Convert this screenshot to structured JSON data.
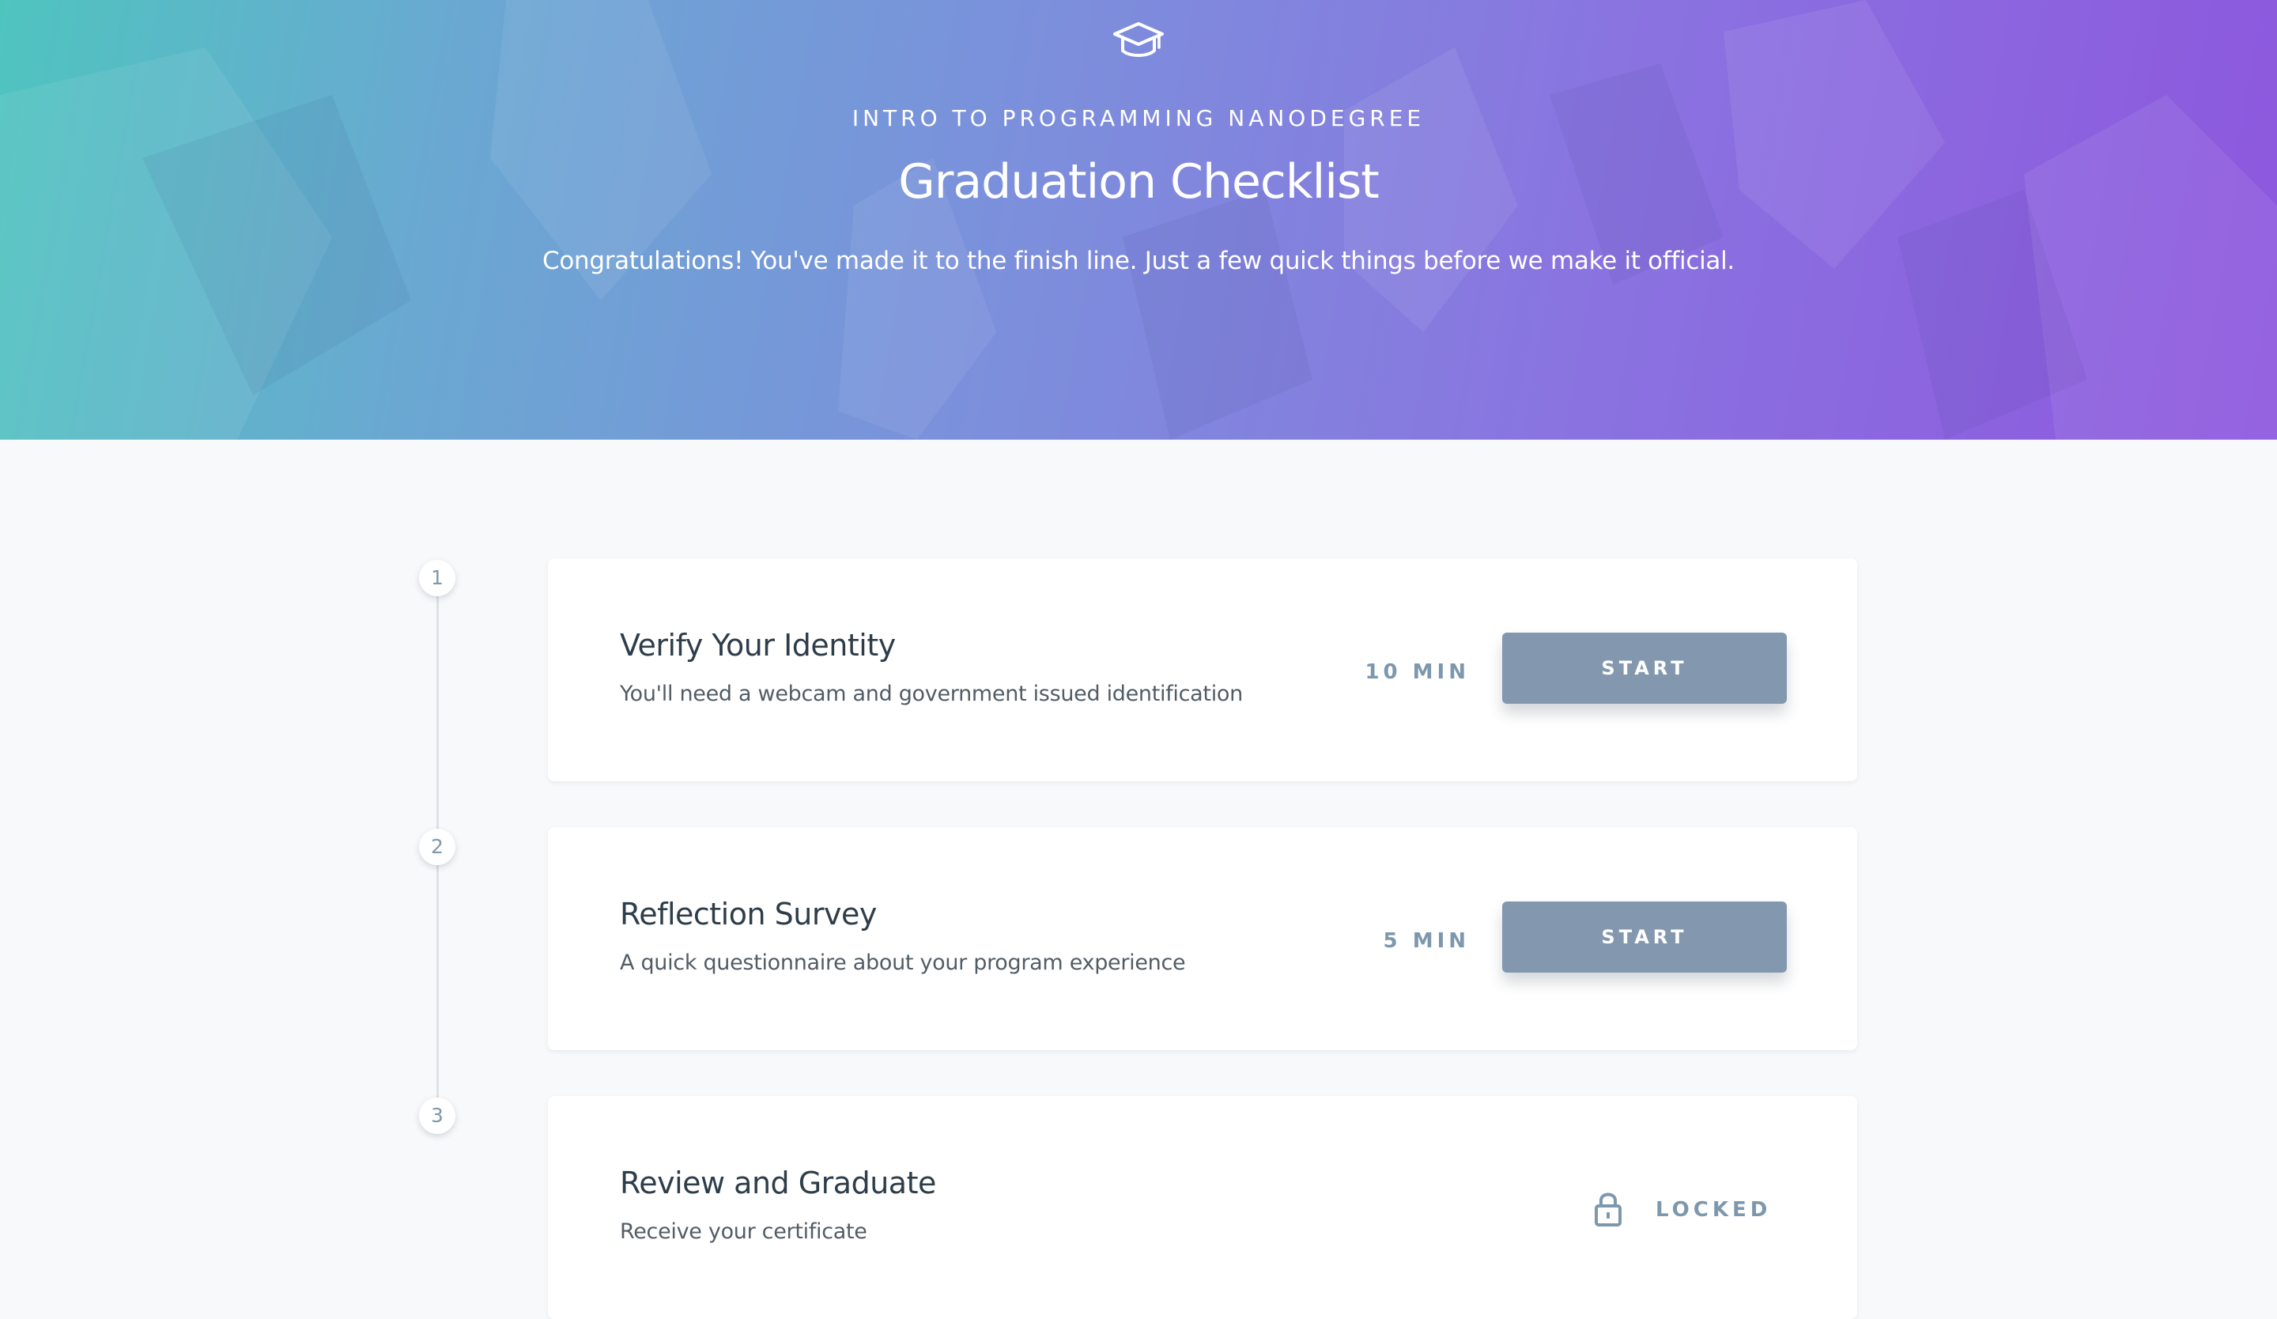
{
  "theme": {
    "hero_gradient": [
      "#4fc4bf",
      "#7c8fdc",
      "#8d57de"
    ],
    "button_color": "#8398ae",
    "muted_text": "#7d97ad",
    "page_background": "#f8f9fb"
  },
  "header": {
    "icon": "graduation-cap-icon",
    "program": "INTRO TO PROGRAMMING NANODEGREE",
    "title": "Graduation Checklist",
    "subtitle": "Congratulations! You've made it to the finish line. Just a few quick things before we make it official."
  },
  "steps": [
    {
      "number": "1",
      "title": "Verify Your Identity",
      "description": "You'll need a webcam and government issued identification",
      "duration": "10 MIN",
      "action": "START"
    },
    {
      "number": "2",
      "title": "Reflection Survey",
      "description": "A quick questionnaire about your program experience",
      "duration": "5 MIN",
      "action": "START"
    },
    {
      "number": "3",
      "title": "Review and Graduate",
      "description": "Receive your certificate",
      "status": "LOCKED",
      "status_icon": "lock-icon"
    }
  ]
}
